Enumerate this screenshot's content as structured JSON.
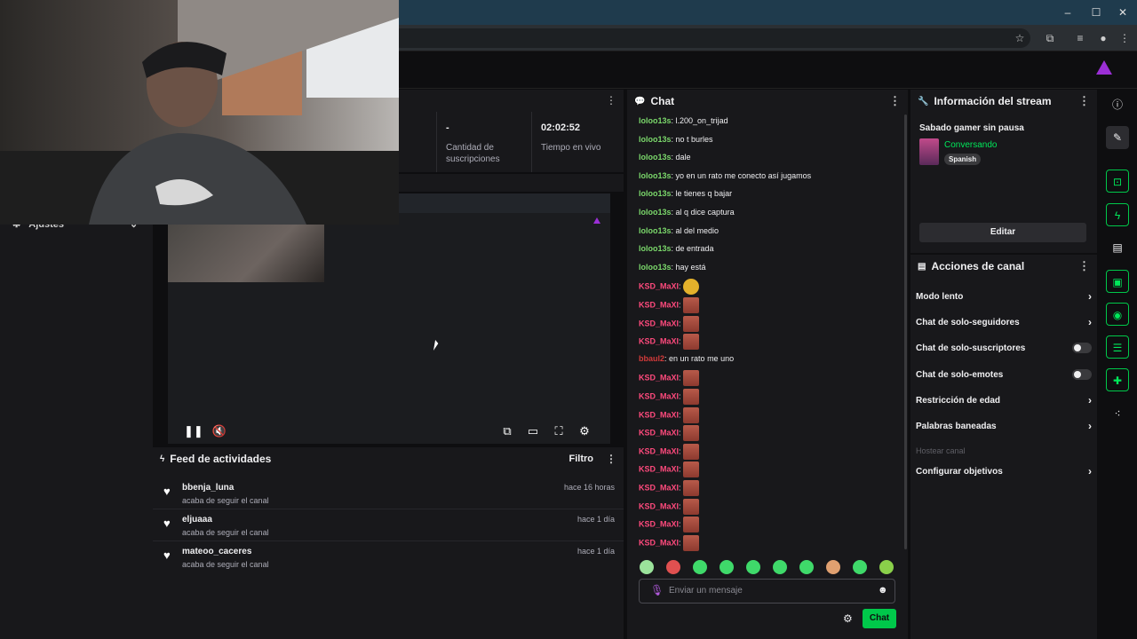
{
  "browser": {
    "window_controls": [
      "–",
      "☐",
      "✕"
    ]
  },
  "stats": {
    "subs_value": "-",
    "subs_label": "Cantidad de suscripciones",
    "live_value": "02:02:52",
    "live_label": "Tiempo en vivo"
  },
  "left_sidebar": {
    "settings_label": "Ajustes"
  },
  "feed": {
    "title": "Feed de actividades",
    "filter_label": "Filtro",
    "items": [
      {
        "user": "bbenja_luna",
        "action": "acaba de seguir el canal",
        "time": "hace 16 horas"
      },
      {
        "user": "eljuaaa",
        "action": "acaba de seguir el canal",
        "time": "hace 1 día"
      },
      {
        "user": "mateoo_caceres",
        "action": "acaba de seguir el canal",
        "time": "hace 1 día"
      }
    ]
  },
  "chat": {
    "title": "Chat",
    "input_placeholder": "Enviar un mensaje",
    "send_label": "Chat",
    "messages": [
      {
        "user": "loloo13s",
        "text": "l.200_on_trijad",
        "color": "#7bd86b"
      },
      {
        "user": "loloo13s",
        "text": "no t burles",
        "color": "#7bd86b"
      },
      {
        "user": "loloo13s",
        "text": "dale",
        "color": "#7bd86b"
      },
      {
        "user": "loloo13s",
        "text": "yo en un rato me conecto así jugamos",
        "color": "#7bd86b"
      },
      {
        "user": "loloo13s",
        "text": "le tienes q bajar",
        "color": "#7bd86b"
      },
      {
        "user": "loloo13s",
        "text": "al q dice captura",
        "color": "#7bd86b"
      },
      {
        "user": "loloo13s",
        "text": "al del medio",
        "color": "#7bd86b"
      },
      {
        "user": "loloo13s",
        "text": "de entrada",
        "color": "#7bd86b"
      },
      {
        "user": "loloo13s",
        "text": "hay está",
        "color": "#7bd86b"
      },
      {
        "user": "KSD_MaXI",
        "text": "",
        "emote": "cat",
        "color": "#ff4a7d"
      },
      {
        "user": "KSD_MaXI",
        "text": "",
        "emote": "face",
        "color": "#ff4a7d"
      },
      {
        "user": "KSD_MaXI",
        "text": "",
        "emote": "face",
        "color": "#ff4a7d"
      },
      {
        "user": "KSD_MaXI",
        "text": "",
        "emote": "face",
        "color": "#ff4a7d"
      },
      {
        "user": "bbaul2",
        "text": "en un rato me uno",
        "color": "#d23a3a"
      },
      {
        "user": "KSD_MaXI",
        "text": "",
        "emote": "face",
        "color": "#ff4a7d"
      },
      {
        "user": "KSD_MaXI",
        "text": "",
        "emote": "face",
        "color": "#ff4a7d"
      },
      {
        "user": "KSD_MaXI",
        "text": "",
        "emote": "face",
        "color": "#ff4a7d"
      },
      {
        "user": "KSD_MaXI",
        "text": "",
        "emote": "face",
        "color": "#ff4a7d"
      },
      {
        "user": "KSD_MaXI",
        "text": "",
        "emote": "face",
        "color": "#ff4a7d"
      },
      {
        "user": "KSD_MaXI",
        "text": "",
        "emote": "face",
        "color": "#ff4a7d"
      },
      {
        "user": "KSD_MaXI",
        "text": "",
        "emote": "face",
        "color": "#ff4a7d"
      },
      {
        "user": "KSD_MaXI",
        "text": "",
        "emote": "face",
        "color": "#ff4a7d"
      },
      {
        "user": "KSD_MaXI",
        "text": "",
        "emote": "face",
        "color": "#ff4a7d"
      },
      {
        "user": "KSD_MaXI",
        "text": "",
        "emote": "face",
        "color": "#ff4a7d"
      }
    ]
  },
  "stream_info": {
    "title": "Información del stream",
    "stream_title": "Sabado gamer sin pausa",
    "category": "Conversando",
    "language_tag": "Spanish",
    "edit_label": "Editar"
  },
  "channel_actions": {
    "title": "Acciones de canal",
    "items": [
      {
        "label": "Modo lento",
        "kind": "arrow"
      },
      {
        "label": "Chat de solo-seguidores",
        "kind": "arrow"
      },
      {
        "label": "Chat de solo-suscriptores",
        "kind": "toggle"
      },
      {
        "label": "Chat de solo-emotes",
        "kind": "toggle"
      },
      {
        "label": "Restricción de edad",
        "kind": "arrow"
      },
      {
        "label": "Palabras baneadas",
        "kind": "arrow"
      },
      {
        "label": "Hostear canal",
        "kind": "disabled"
      },
      {
        "label": "Configurar objetivos",
        "kind": "arrow"
      }
    ]
  },
  "colors": {
    "accent_green": "#00c84a",
    "brand_purple": "#9b2fd6",
    "username_green": "#7bd86b",
    "username_pink": "#ff4a7d"
  }
}
